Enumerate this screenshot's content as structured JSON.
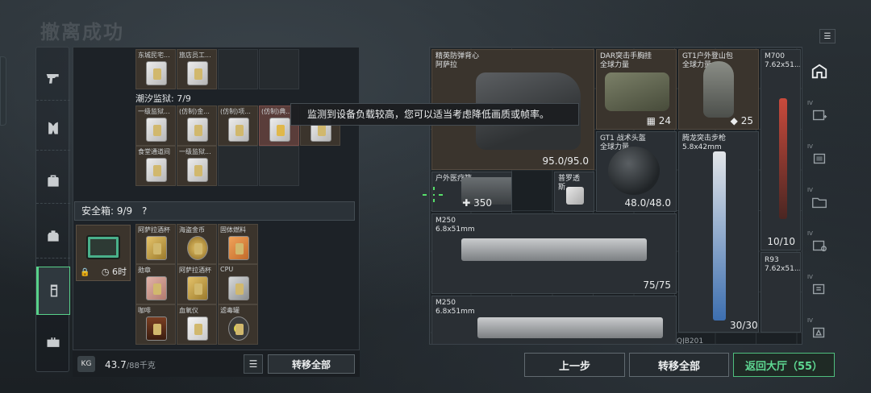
{
  "page": {
    "title": "撤离成功"
  },
  "tooltip": "监测到设备负载较高，您可以适当考虑降低画质或帧率。",
  "left_panel": {
    "top_row_names": [
      "东城民宅...",
      "旅店员工..."
    ],
    "prison_label": "潮汐监狱: 7/9",
    "prison_row1": [
      "一级监狱...",
      "(仿制)金...",
      "(仿制)项...",
      "(仿制)典...",
      ""
    ],
    "prison_row2": [
      "食堂通道间",
      "一级监狱..."
    ],
    "safebox_label": "安全箱: 9/9",
    "safebox_help": "?",
    "safebox_time": "6时",
    "safebox_items": [
      [
        "阿萨拉酒杯",
        "海盗金币",
        "固体燃料"
      ],
      [
        "勋章",
        "阿萨拉酒杯",
        "CPU"
      ],
      [
        "咖啡",
        "血氧仪",
        "滤毒罐"
      ]
    ],
    "weight_icon": "KG",
    "weight": "43.7",
    "weight_max": "/88千克",
    "transfer_all": "转移全部"
  },
  "right_panel": {
    "vest_name": "精英防弹背心",
    "vest_sub": "阿萨拉",
    "vest_durability": "95.0/95.0",
    "chest_rig_name": "DAR突击手胸挂",
    "chest_rig_sub": "全球力量",
    "chest_rig_count": "24",
    "backpack_name": "GT1户外登山包",
    "backpack_sub": "全球力量",
    "backpack_count": "25",
    "m700_name": "M700",
    "m700_ammo": "7.62x51...",
    "helmet_name": "GT1 战术头盔",
    "helmet_sub": "全球力量",
    "helmet_durability": "48.0/48.0",
    "rifle_name": "腾龙突击步枪",
    "rifle_ammo": "5.8x42mm",
    "medkit_name": "户外医疗箱",
    "medkit_count": "350",
    "small_item_name": "普罗透斯...",
    "m250_name": "M250",
    "m250_ammo": "6.8x51mm",
    "m250_count": "75/75",
    "m250b_name": "M250",
    "m250b_ammo": "6.8x51mm",
    "m250b_count": "30/30",
    "r93_name": "R93",
    "r93_ammo": "7.62x51...",
    "r93_count": "10/10",
    "bottom_cut_label": "QJB201"
  },
  "right_side": {
    "labels": [
      "IV",
      "IV",
      "IV",
      "IV",
      "IV",
      "IV"
    ]
  },
  "bottom": {
    "prev": "上一步",
    "transfer_all": "转移全部",
    "back_lobby": "返回大厅（55）"
  },
  "colors": {
    "accent": "#58d28a",
    "item_bg": "#3b342c"
  }
}
